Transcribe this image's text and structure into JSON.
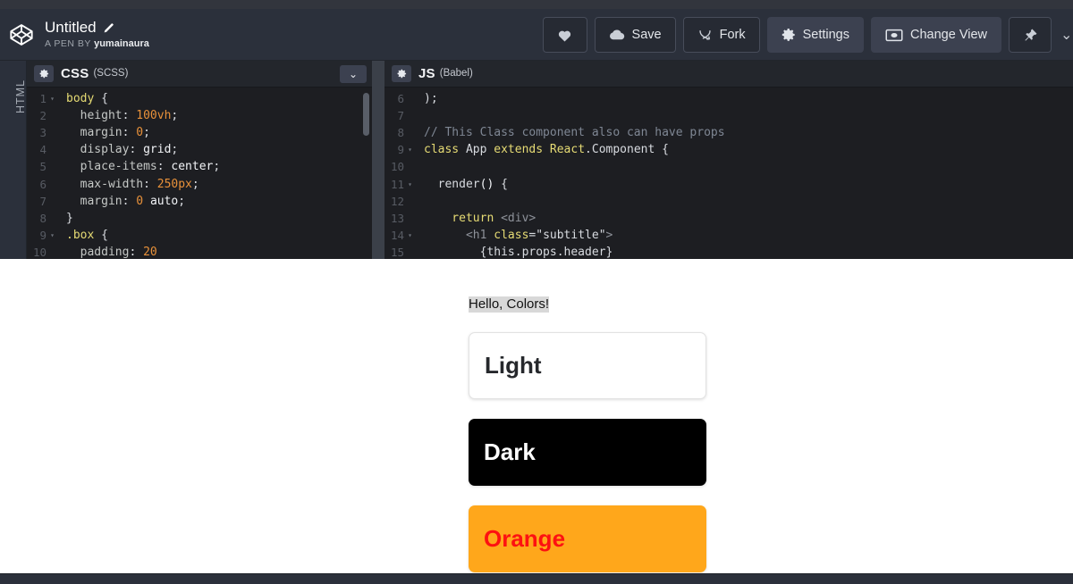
{
  "header": {
    "logo_icon": "codepen-logo-icon",
    "pen_title": "Untitled",
    "edit_icon": "pencil-icon",
    "byline_prefix": "A PEN BY",
    "author": "yumainaura",
    "buttons": [
      {
        "id": "love",
        "label": "",
        "icon": "heart-icon",
        "style": "outline",
        "icon_only": true
      },
      {
        "id": "save",
        "label": "Save",
        "icon": "cloud-icon",
        "style": "outline",
        "icon_only": false
      },
      {
        "id": "fork",
        "label": "Fork",
        "icon": "fork-icon",
        "style": "outline",
        "icon_only": false
      },
      {
        "id": "settings",
        "label": "Settings",
        "icon": "gear-icon",
        "style": "filled",
        "icon_only": false
      },
      {
        "id": "change-view",
        "label": "Change View",
        "icon": "layout-icon",
        "style": "filled",
        "icon_only": false
      },
      {
        "id": "pin",
        "label": "",
        "icon": "pin-icon",
        "style": "outline",
        "icon_only": true
      }
    ],
    "edge_chevron": "chevron-down-icon"
  },
  "rail": {
    "label": "HTML"
  },
  "editors": {
    "css": {
      "gear_icon": "gear-icon",
      "lang": "CSS",
      "lang_sub": "(SCSS)",
      "chevron_icon": "chevron-down-icon",
      "lines": [
        {
          "n": "1",
          "fold": true,
          "tokens": [
            {
              "c": "t-sel",
              "t": "body "
            },
            {
              "c": "t-punc",
              "t": "{"
            }
          ]
        },
        {
          "n": "2",
          "fold": false,
          "tokens": [
            {
              "c": "t-prop",
              "t": "  height"
            },
            {
              "c": "t-punc",
              "t": ": "
            },
            {
              "c": "t-num",
              "t": "100vh"
            },
            {
              "c": "t-punc",
              "t": ";"
            }
          ]
        },
        {
          "n": "3",
          "fold": false,
          "tokens": [
            {
              "c": "t-prop",
              "t": "  margin"
            },
            {
              "c": "t-punc",
              "t": ": "
            },
            {
              "c": "t-num",
              "t": "0"
            },
            {
              "c": "t-punc",
              "t": ";"
            }
          ]
        },
        {
          "n": "4",
          "fold": false,
          "tokens": [
            {
              "c": "t-prop",
              "t": "  display"
            },
            {
              "c": "t-punc",
              "t": ": "
            },
            {
              "c": "t-white",
              "t": "grid"
            },
            {
              "c": "t-punc",
              "t": ";"
            }
          ]
        },
        {
          "n": "5",
          "fold": false,
          "tokens": [
            {
              "c": "t-prop",
              "t": "  place-items"
            },
            {
              "c": "t-punc",
              "t": ": "
            },
            {
              "c": "t-white",
              "t": "center"
            },
            {
              "c": "t-punc",
              "t": ";"
            }
          ]
        },
        {
          "n": "6",
          "fold": false,
          "tokens": [
            {
              "c": "t-prop",
              "t": "  max-width"
            },
            {
              "c": "t-punc",
              "t": ": "
            },
            {
              "c": "t-num",
              "t": "250px"
            },
            {
              "c": "t-punc",
              "t": ";"
            }
          ]
        },
        {
          "n": "7",
          "fold": false,
          "tokens": [
            {
              "c": "t-prop",
              "t": "  margin"
            },
            {
              "c": "t-punc",
              "t": ": "
            },
            {
              "c": "t-num",
              "t": "0 "
            },
            {
              "c": "t-white",
              "t": "auto"
            },
            {
              "c": "t-punc",
              "t": ";"
            }
          ]
        },
        {
          "n": "8",
          "fold": false,
          "tokens": [
            {
              "c": "t-punc",
              "t": "}"
            }
          ]
        },
        {
          "n": "9",
          "fold": true,
          "tokens": [
            {
              "c": "t-sel",
              "t": ".box "
            },
            {
              "c": "t-punc",
              "t": "{"
            }
          ]
        },
        {
          "n": "10",
          "fold": false,
          "tokens": [
            {
              "c": "t-prop",
              "t": "  padding"
            },
            {
              "c": "t-punc",
              "t": ": "
            },
            {
              "c": "t-num",
              "t": "20"
            }
          ]
        }
      ]
    },
    "js": {
      "gear_icon": "gear-icon",
      "lang": "JS",
      "lang_sub": "(Babel)",
      "lines": [
        {
          "n": "6",
          "fold": false,
          "tokens": [
            {
              "c": "t-plain",
              "t": ");"
            }
          ]
        },
        {
          "n": "7",
          "fold": false,
          "tokens": [
            {
              "c": "t-plain",
              "t": ""
            }
          ]
        },
        {
          "n": "8",
          "fold": false,
          "tokens": [
            {
              "c": "t-cmt",
              "t": "// This Class component also can have props"
            }
          ]
        },
        {
          "n": "9",
          "fold": true,
          "tokens": [
            {
              "c": "t-kw",
              "t": "class "
            },
            {
              "c": "t-plain",
              "t": "App "
            },
            {
              "c": "t-kw",
              "t": "extends "
            },
            {
              "c": "t-kw",
              "t": "React"
            },
            {
              "c": "t-plain",
              "t": ".Component {"
            }
          ]
        },
        {
          "n": "10",
          "fold": false,
          "tokens": [
            {
              "c": "t-plain",
              "t": ""
            }
          ]
        },
        {
          "n": "11",
          "fold": true,
          "tokens": [
            {
              "c": "t-plain",
              "t": "  render"
            },
            {
              "c": "t-white",
              "t": "()"
            },
            {
              "c": "t-plain",
              "t": " {"
            }
          ]
        },
        {
          "n": "12",
          "fold": false,
          "tokens": [
            {
              "c": "t-plain",
              "t": ""
            }
          ]
        },
        {
          "n": "13",
          "fold": false,
          "tokens": [
            {
              "c": "t-kw",
              "t": "    return "
            },
            {
              "c": "t-tag",
              "t": "<div>"
            }
          ]
        },
        {
          "n": "14",
          "fold": true,
          "tokens": [
            {
              "c": "t-tag",
              "t": "      <h1 "
            },
            {
              "c": "t-attr",
              "t": "class"
            },
            {
              "c": "t-punc",
              "t": "="
            },
            {
              "c": "t-str",
              "t": "\"subtitle\""
            },
            {
              "c": "t-tag",
              "t": ">"
            }
          ]
        },
        {
          "n": "15",
          "fold": false,
          "tokens": [
            {
              "c": "t-plain",
              "t": "        {this.props.header}"
            }
          ]
        }
      ]
    }
  },
  "preview": {
    "subtitle": "Hello, Colors!",
    "boxes": [
      {
        "label": "Light",
        "variant": "light",
        "bg": "#ffffff",
        "fg": "#26282c"
      },
      {
        "label": "Dark",
        "variant": "dark",
        "bg": "#000000",
        "fg": "#ffffff"
      },
      {
        "label": "Orange",
        "variant": "orange",
        "bg": "#ffa71b",
        "fg": "#fd1111"
      }
    ]
  }
}
